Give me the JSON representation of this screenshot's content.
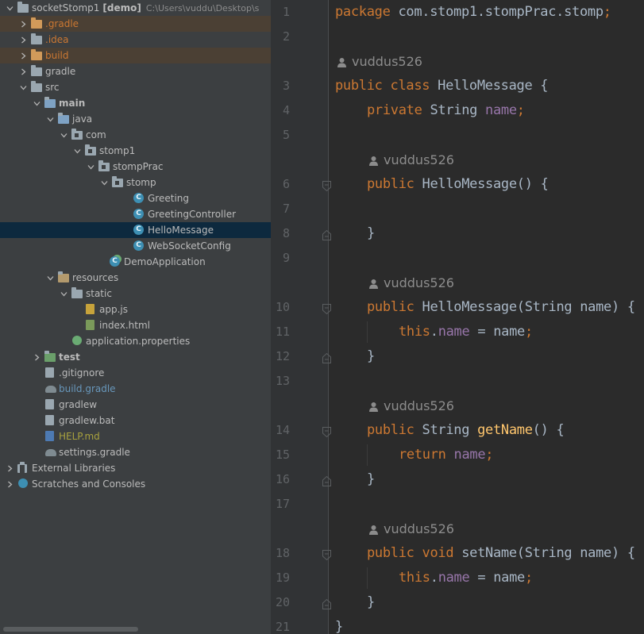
{
  "project_tree": {
    "rows": [
      {
        "name": "socketStomp1",
        "suffix": "[demo]",
        "path": "C:\\Users\\vuddu\\Desktop\\s",
        "depth": 0,
        "expanded": true,
        "icon": "module-folder-icon",
        "style": "bold-root"
      },
      {
        "name": ".gradle",
        "depth": 1,
        "expanded": false,
        "icon": "excluded-folder-icon",
        "style": "excluded"
      },
      {
        "name": ".idea",
        "depth": 1,
        "expanded": false,
        "icon": "folder-icon",
        "style": "excluded-text"
      },
      {
        "name": "build",
        "depth": 1,
        "expanded": false,
        "icon": "excluded-folder-icon",
        "style": "excluded"
      },
      {
        "name": "gradle",
        "depth": 1,
        "expanded": false,
        "icon": "folder-icon",
        "style": "normal"
      },
      {
        "name": "src",
        "depth": 1,
        "expanded": true,
        "icon": "folder-icon",
        "style": "normal"
      },
      {
        "name": "main",
        "depth": 2,
        "expanded": true,
        "icon": "source-folder-icon",
        "style": "bold"
      },
      {
        "name": "java",
        "depth": 3,
        "expanded": true,
        "icon": "java-source-folder-icon",
        "style": "normal"
      },
      {
        "name": "com",
        "depth": 4,
        "expanded": true,
        "icon": "package-icon",
        "style": "normal"
      },
      {
        "name": "stomp1",
        "depth": 5,
        "expanded": true,
        "icon": "package-icon",
        "style": "normal"
      },
      {
        "name": "stompPrac",
        "depth": 6,
        "expanded": true,
        "icon": "package-icon",
        "style": "normal"
      },
      {
        "name": "stomp",
        "depth": 7,
        "expanded": true,
        "icon": "package-icon",
        "style": "normal"
      },
      {
        "name": "Greeting",
        "depth": 8,
        "icon": "class-icon",
        "style": "normal"
      },
      {
        "name": "GreetingController",
        "depth": 8,
        "icon": "class-icon",
        "style": "normal"
      },
      {
        "name": "HelloMessage",
        "depth": 8,
        "icon": "class-icon",
        "style": "selected"
      },
      {
        "name": "WebSocketConfig",
        "depth": 8,
        "icon": "class-icon",
        "style": "normal"
      },
      {
        "name": "DemoApplication",
        "depth": 7,
        "icon": "spring-boot-class-icon",
        "style": "normal"
      },
      {
        "name": "resources",
        "depth": 3,
        "expanded": true,
        "icon": "resources-folder-icon",
        "style": "normal"
      },
      {
        "name": "static",
        "depth": 4,
        "expanded": true,
        "icon": "folder-icon",
        "style": "normal"
      },
      {
        "name": "app.js",
        "depth": 5,
        "icon": "javascript-file-icon",
        "style": "normal"
      },
      {
        "name": "index.html",
        "depth": 5,
        "icon": "html-file-icon",
        "style": "normal"
      },
      {
        "name": "application.properties",
        "depth": 4,
        "icon": "spring-properties-icon",
        "style": "normal"
      },
      {
        "name": "test",
        "depth": 2,
        "expanded": false,
        "icon": "test-folder-icon",
        "style": "bold"
      },
      {
        "name": ".gitignore",
        "depth": 2,
        "icon": "gitignore-file-icon",
        "style": "normal"
      },
      {
        "name": "build.gradle",
        "depth": 2,
        "icon": "gradle-icon",
        "style": "blue"
      },
      {
        "name": "gradlew",
        "depth": 2,
        "icon": "text-file-icon",
        "style": "normal"
      },
      {
        "name": "gradlew.bat",
        "depth": 2,
        "icon": "text-file-icon",
        "style": "normal"
      },
      {
        "name": "HELP.md",
        "depth": 2,
        "icon": "markdown-file-icon",
        "style": "olive"
      },
      {
        "name": "settings.gradle",
        "depth": 2,
        "icon": "gradle-icon",
        "style": "normal"
      },
      {
        "name": "External Libraries",
        "depth": 0,
        "expanded": false,
        "icon": "libraries-icon",
        "style": "normal"
      },
      {
        "name": "Scratches and Consoles",
        "depth": 0,
        "expanded": false,
        "icon": "scratches-icon",
        "style": "normal"
      }
    ]
  },
  "editor": {
    "author_hint": "vuddus526",
    "lines": [
      {
        "kind": "code",
        "num": "1",
        "indent": 0,
        "tokens": [
          [
            "kw",
            "package "
          ],
          [
            "plain",
            "com.stomp1.stompPrac.stomp"
          ],
          [
            "kw",
            ";"
          ]
        ]
      },
      {
        "kind": "code",
        "num": "2",
        "indent": 0,
        "tokens": []
      },
      {
        "kind": "author",
        "indent": 0
      },
      {
        "kind": "code",
        "num": "3",
        "indent": 0,
        "tokens": [
          [
            "kw",
            "public class "
          ],
          [
            "plain",
            "HelloMessage {"
          ]
        ]
      },
      {
        "kind": "code",
        "num": "4",
        "indent": 1,
        "tokens": [
          [
            "kw",
            "private "
          ],
          [
            "plain",
            "String "
          ],
          [
            "fld",
            "name"
          ],
          [
            "kw",
            ";"
          ]
        ]
      },
      {
        "kind": "code",
        "num": "5",
        "indent": 0,
        "tokens": []
      },
      {
        "kind": "author",
        "indent": 1
      },
      {
        "kind": "code",
        "num": "6",
        "indent": 1,
        "fold": "open",
        "tokens": [
          [
            "kw",
            "public "
          ],
          [
            "dimfn",
            "HelloMessage"
          ],
          [
            "plain",
            "() {"
          ]
        ]
      },
      {
        "kind": "code",
        "num": "7",
        "indent": 0,
        "tokens": []
      },
      {
        "kind": "code",
        "num": "8",
        "indent": 1,
        "fold": "close",
        "tokens": [
          [
            "plain",
            "}"
          ]
        ]
      },
      {
        "kind": "code",
        "num": "9",
        "indent": 0,
        "tokens": []
      },
      {
        "kind": "author",
        "indent": 1
      },
      {
        "kind": "code",
        "num": "10",
        "indent": 1,
        "fold": "open",
        "tokens": [
          [
            "kw",
            "public "
          ],
          [
            "dimfn",
            "HelloMessage"
          ],
          [
            "plain",
            "(String name) {"
          ]
        ]
      },
      {
        "kind": "code",
        "num": "11",
        "indent": 2,
        "guide": true,
        "tokens": [
          [
            "kw",
            "this"
          ],
          [
            "plain",
            "."
          ],
          [
            "fld",
            "name"
          ],
          [
            "plain",
            " = name"
          ],
          [
            "kw",
            ";"
          ]
        ]
      },
      {
        "kind": "code",
        "num": "12",
        "indent": 1,
        "fold": "close",
        "tokens": [
          [
            "plain",
            "}"
          ]
        ]
      },
      {
        "kind": "code",
        "num": "13",
        "indent": 0,
        "tokens": []
      },
      {
        "kind": "author",
        "indent": 1
      },
      {
        "kind": "code",
        "num": "14",
        "indent": 1,
        "fold": "open",
        "tokens": [
          [
            "kw",
            "public "
          ],
          [
            "plain",
            "String "
          ],
          [
            "fn",
            "getName"
          ],
          [
            "plain",
            "() {"
          ]
        ]
      },
      {
        "kind": "code",
        "num": "15",
        "indent": 2,
        "guide": true,
        "tokens": [
          [
            "kw",
            "return "
          ],
          [
            "fld",
            "name"
          ],
          [
            "kw",
            ";"
          ]
        ]
      },
      {
        "kind": "code",
        "num": "16",
        "indent": 1,
        "fold": "close",
        "tokens": [
          [
            "plain",
            "}"
          ]
        ]
      },
      {
        "kind": "code",
        "num": "17",
        "indent": 0,
        "tokens": []
      },
      {
        "kind": "author",
        "indent": 1
      },
      {
        "kind": "code",
        "num": "18",
        "indent": 1,
        "fold": "open",
        "tokens": [
          [
            "kw",
            "public void "
          ],
          [
            "dimfn",
            "setName"
          ],
          [
            "plain",
            "(String name) {"
          ]
        ]
      },
      {
        "kind": "code",
        "num": "19",
        "indent": 2,
        "guide": true,
        "tokens": [
          [
            "kw",
            "this"
          ],
          [
            "plain",
            "."
          ],
          [
            "fld",
            "name"
          ],
          [
            "plain",
            " = name"
          ],
          [
            "kw",
            ";"
          ]
        ]
      },
      {
        "kind": "code",
        "num": "20",
        "indent": 1,
        "fold": "close",
        "tokens": [
          [
            "plain",
            "}"
          ]
        ]
      },
      {
        "kind": "code",
        "num": "21",
        "indent": 0,
        "tokens": [
          [
            "plain",
            "}"
          ]
        ]
      }
    ]
  },
  "colors": {
    "keyword": "#cc7832",
    "field": "#9876aa",
    "method": "#ffc66d",
    "text": "#a9b7c6",
    "selection": "#0d293e",
    "excluded_bg": "#4b4034"
  }
}
